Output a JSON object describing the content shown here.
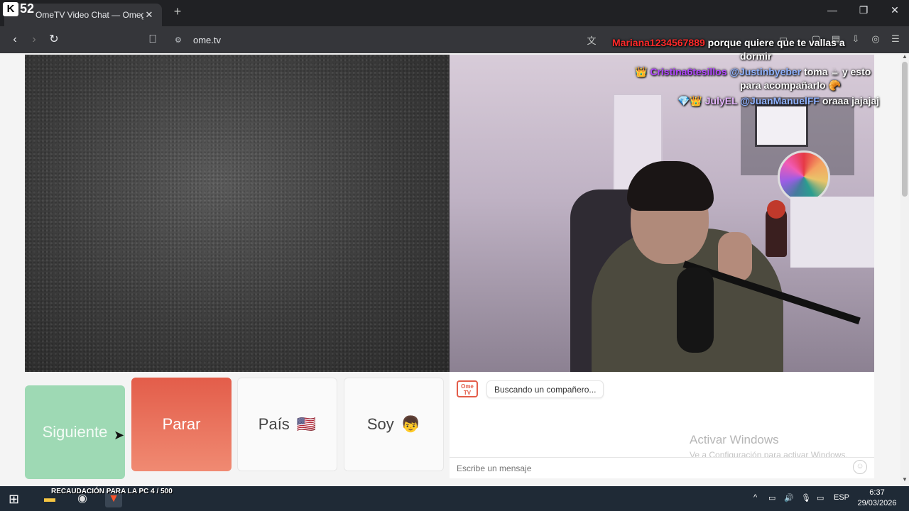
{
  "browser": {
    "tab_title": "OmeTV Video Chat — Omegl",
    "counter_value": "52",
    "url": "ome.tv"
  },
  "chat_overlay": [
    {
      "user": "Mariana1234567889",
      "user_color": "#ff2a2a",
      "text": "porque quiere que te vallas a",
      "text2": "dormir"
    },
    {
      "user": "Cristina6tesillos",
      "user_color": "#b146ff",
      "mention": "@Justinbyeber",
      "text": "toma ☕ y esto",
      "text2": "para acompañarlo 🥐"
    },
    {
      "user": "JulyEL",
      "user_color": "#e7b6ff",
      "mention": "@JuanManuelFF",
      "text": "oraaa jajajaj"
    }
  ],
  "controls": {
    "next": "Siguiente",
    "stop": "Parar",
    "country": "País",
    "country_flag": "🇺🇸",
    "gender": "Soy",
    "gender_emoji": "👦"
  },
  "chat": {
    "logo_text": "Ome TV",
    "status": "Buscando un compañero...",
    "input_placeholder": "Escribe un mensaje",
    "watermark_title": "Activar Windows",
    "watermark_sub": "Ve a Configuración para activar Windows."
  },
  "taskbar": {
    "donation": "RECAUDACIÓN PARA LA PC 4 / 500",
    "lang": "ESP",
    "time": "6:37",
    "date": "29/03/2026"
  },
  "colors": {
    "next_bg": "#9ed9b4",
    "stop_bg": "#e35d4a",
    "accent": "#e35d4a"
  }
}
